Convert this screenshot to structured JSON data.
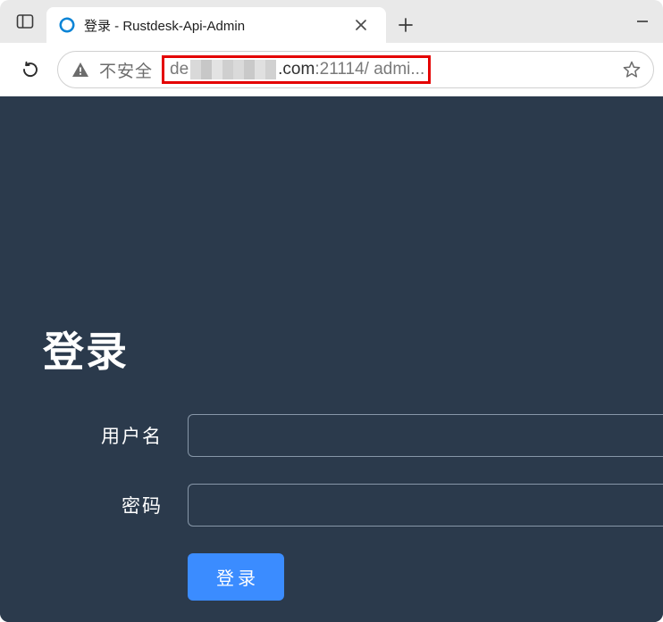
{
  "browser": {
    "tab_title": "登录 - Rustdesk-Api-Admin",
    "insecure_label": "不安全",
    "url_pre": "de",
    "url_host_suffix": ".com",
    "url_port": ":21114",
    "url_path": "/ admi..."
  },
  "login": {
    "heading": "登录",
    "username_label": "用户名",
    "password_label": "密码",
    "submit_label": "登录"
  }
}
